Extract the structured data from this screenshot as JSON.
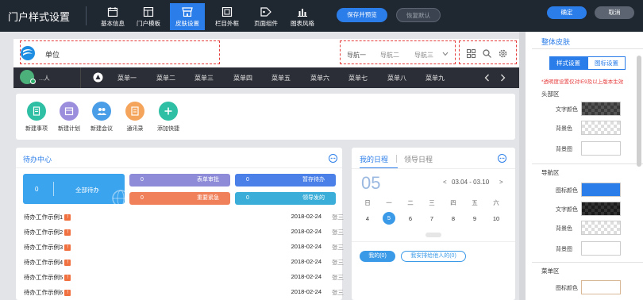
{
  "app": {
    "title": "门户样式设置"
  },
  "toolbar": {
    "items": [
      {
        "label": "基本信息",
        "icon": "calendar-icon"
      },
      {
        "label": "门户模板",
        "icon": "template-icon"
      },
      {
        "label": "皮肤设置",
        "icon": "shop-icon",
        "active": true
      },
      {
        "label": "栏目外框",
        "icon": "frame-icon"
      },
      {
        "label": "页面组件",
        "icon": "tag-icon"
      },
      {
        "label": "图表风格",
        "icon": "chart-icon"
      }
    ],
    "save_preview": "保存并预览",
    "restore_default": "恢复默认",
    "confirm": "确定",
    "cancel": "取消"
  },
  "preview": {
    "header": {
      "company": "单位",
      "nav": [
        "导航一",
        "导航二",
        "导航三"
      ],
      "icons": [
        "apps-icon",
        "search-icon",
        "gear-icon"
      ]
    },
    "menubar": {
      "user": "...人",
      "items": [
        "菜单一",
        "菜单二",
        "菜单三",
        "菜单四",
        "菜单五",
        "菜单六",
        "菜单七",
        "菜单八",
        "菜单九"
      ]
    },
    "quick_actions": [
      {
        "label": "新建事项",
        "color": "#2fbfa5",
        "icon": "doc-icon"
      },
      {
        "label": "新建计划",
        "color": "#9b8fdd",
        "icon": "plan-icon"
      },
      {
        "label": "新建会议",
        "color": "#4a9ee8",
        "icon": "meeting-icon"
      },
      {
        "label": "通讯录",
        "color": "#f5a55b",
        "icon": "contacts-icon"
      },
      {
        "label": "添加快捷",
        "color": "#2fbfa5",
        "icon": "plus-icon"
      }
    ],
    "todo": {
      "title": "待办中心",
      "all": {
        "count": "0",
        "label": "全部待办"
      },
      "stats": [
        {
          "count": "0",
          "label": "表单审批",
          "color": "#8e8cd8"
        },
        {
          "count": "0",
          "label": "暂存待办",
          "color": "#4a80e8"
        },
        {
          "count": "0",
          "label": "重要紧急",
          "color": "#f0805a"
        },
        {
          "count": "0",
          "label": "领导发的",
          "color": "#3aaed8"
        }
      ],
      "rows": [
        {
          "title": "待办工作示例1",
          "date": "2018-02-24",
          "user": "张三"
        },
        {
          "title": "待办工作示例2",
          "date": "2018-02-24",
          "user": "张三"
        },
        {
          "title": "待办工作示例3",
          "date": "2018-02-24",
          "user": "张三"
        },
        {
          "title": "待办工作示例4",
          "date": "2018-02-24",
          "user": "张三"
        },
        {
          "title": "待办工作示例5",
          "date": "2018-02-24",
          "user": "张三"
        },
        {
          "title": "待办工作示例6",
          "date": "2018-02-24",
          "user": "张三"
        }
      ],
      "tag": "!"
    },
    "schedule": {
      "tab_mine": "我的日程",
      "tab_leader": "领导日程",
      "day": "05",
      "range": "03.04 - 03.10",
      "prev": "<",
      "next": ">",
      "weekdays": [
        "日",
        "一",
        "二",
        "三",
        "四",
        "五",
        "六"
      ],
      "dates": [
        "4",
        "5",
        "6",
        "7",
        "8",
        "9",
        "10"
      ],
      "selected_index": 1,
      "btn_mine": "我的(0)",
      "btn_arranged": "我安排给他人的(0)"
    }
  },
  "panel": {
    "title": "整体皮肤",
    "tabs": [
      "样式设置",
      "图标设置"
    ],
    "note": "*透明度设置仅对IE9及以上版本生效",
    "sections": [
      {
        "title": "头部区",
        "items": [
          {
            "label": "文字颜色",
            "swatch": "#3a3a3a",
            "checker": true
          },
          {
            "label": "背景色",
            "swatch": "",
            "checker": true
          },
          {
            "label": "背景图",
            "swatch": "#ffffff",
            "checker": false
          }
        ]
      },
      {
        "title": "导航区",
        "items": [
          {
            "label": "图标颜色",
            "swatch": "#2b7de9",
            "checker": false
          },
          {
            "label": "文字颜色",
            "swatch": "#1c1c1c",
            "checker": true
          },
          {
            "label": "背景色",
            "swatch": "",
            "checker": true
          },
          {
            "label": "背景图",
            "swatch": "#ffffff",
            "checker": false
          }
        ]
      },
      {
        "title": "菜单区",
        "items": [
          {
            "label": "图标颜色",
            "swatch": "#ffffff",
            "checker": false
          }
        ]
      }
    ]
  }
}
